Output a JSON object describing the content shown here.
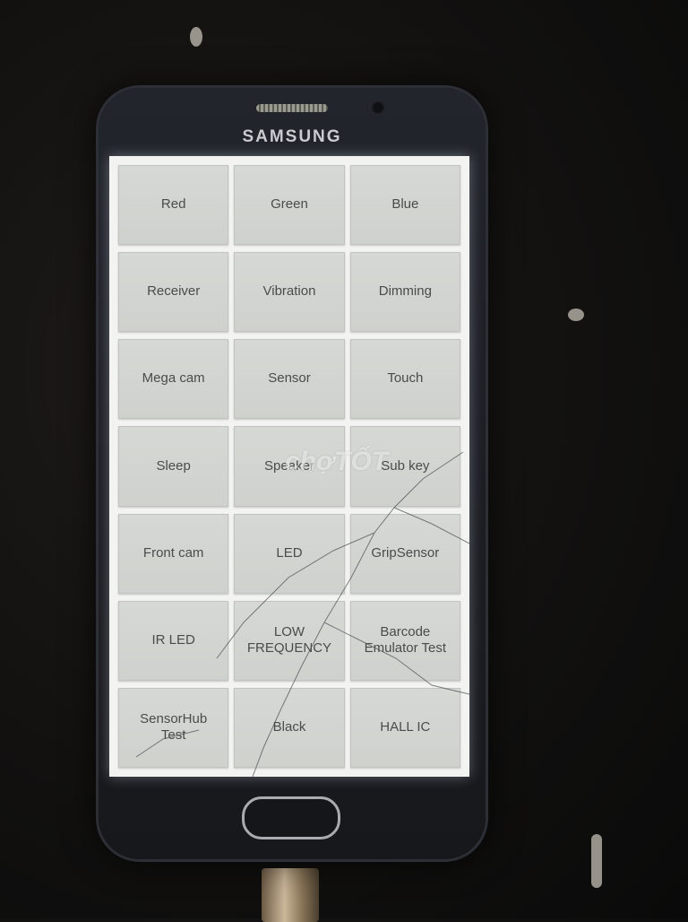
{
  "device": {
    "brand": "SAMSUNG"
  },
  "menu": {
    "buttons": [
      "Red",
      "Green",
      "Blue",
      "Receiver",
      "Vibration",
      "Dimming",
      "Mega cam",
      "Sensor",
      "Touch",
      "Sleep",
      "Speaker",
      "Sub key",
      "Front cam",
      "LED",
      "GripSensor",
      "IR LED",
      "LOW\nFREQUENCY",
      "Barcode\nEmulator Test",
      "SensorHub\nTest",
      "Black",
      "HALL IC"
    ]
  },
  "watermark": "chợTỐT"
}
